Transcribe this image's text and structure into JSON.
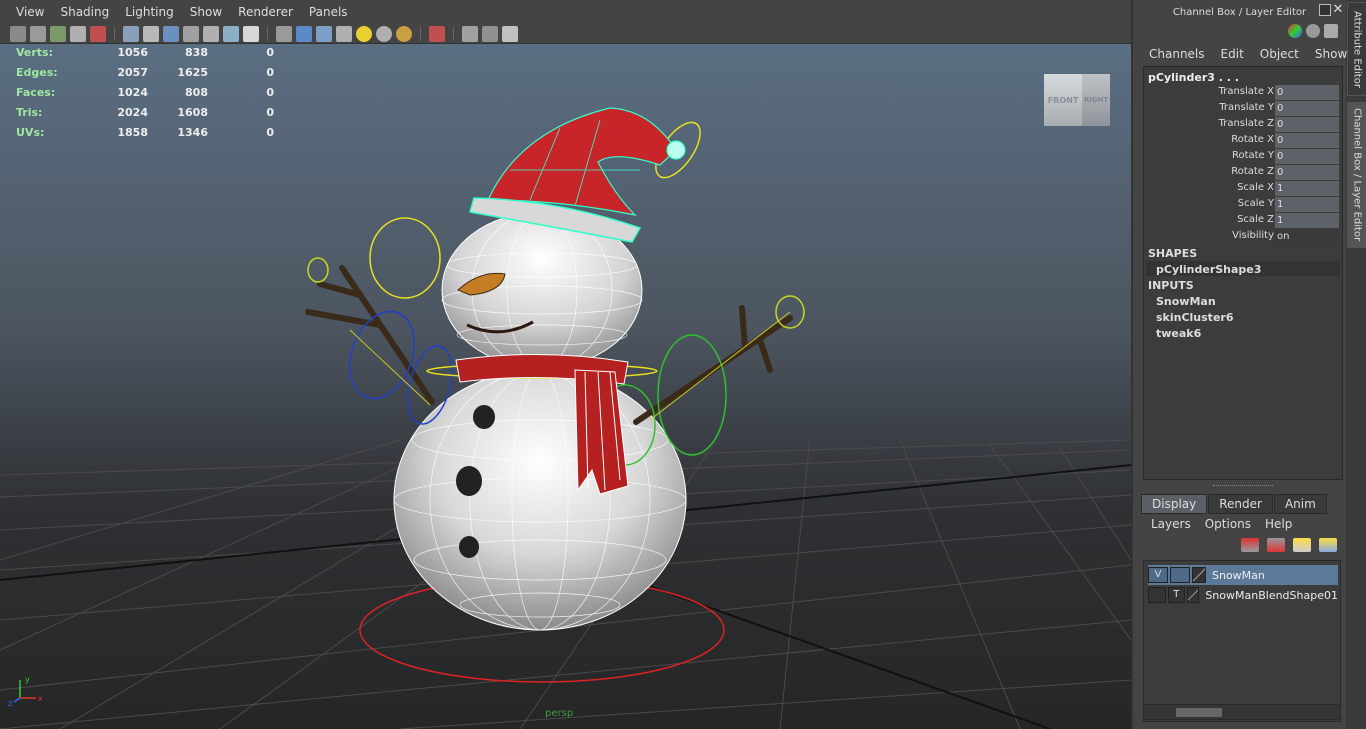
{
  "viewport": {
    "menus": [
      "View",
      "Shading",
      "Lighting",
      "Show",
      "Renderer",
      "Panels"
    ],
    "hud": [
      {
        "label": "Verts:",
        "values": [
          "1056",
          "838",
          "0"
        ]
      },
      {
        "label": "Edges:",
        "values": [
          "2057",
          "1625",
          "0"
        ]
      },
      {
        "label": "Faces:",
        "values": [
          "1024",
          "808",
          "0"
        ]
      },
      {
        "label": "Tris:",
        "values": [
          "2024",
          "1608",
          "0"
        ]
      },
      {
        "label": "UVs:",
        "values": [
          "1858",
          "1346",
          "0"
        ]
      }
    ],
    "viewcube": {
      "front": "FRONT",
      "right": "RIGHT"
    },
    "camera_label": "persp",
    "axis": {
      "x": "x",
      "y": "y",
      "z": "z"
    }
  },
  "panel": {
    "title": "Channel Box / Layer Editor",
    "side_tabs": {
      "attr": "Attribute Editor",
      "cb": "Channel Box / Layer Editor"
    },
    "menu": [
      "Channels",
      "Edit",
      "Object",
      "Show"
    ],
    "node": "pCylinder3 . . .",
    "attrs": [
      {
        "name": "Translate X",
        "value": "0"
      },
      {
        "name": "Translate Y",
        "value": "0"
      },
      {
        "name": "Translate Z",
        "value": "0"
      },
      {
        "name": "Rotate X",
        "value": "0"
      },
      {
        "name": "Rotate Y",
        "value": "0"
      },
      {
        "name": "Rotate Z",
        "value": "0"
      },
      {
        "name": "Scale X",
        "value": "1"
      },
      {
        "name": "Scale Y",
        "value": "1"
      },
      {
        "name": "Scale Z",
        "value": "1"
      },
      {
        "name": "Visibility",
        "value": "on"
      }
    ],
    "shapes_header": "SHAPES",
    "shape": "pCylinderShape3",
    "inputs_header": "INPUTS",
    "inputs": [
      "SnowMan",
      "skinCluster6",
      "tweak6"
    ]
  },
  "layers": {
    "tabs": [
      "Display",
      "Render",
      "Anim"
    ],
    "menu": [
      "Layers",
      "Options",
      "Help"
    ],
    "rows": [
      {
        "v": "V",
        "t": "",
        "name": "SnowMan"
      },
      {
        "v": "",
        "t": "T",
        "name": "SnowManBlendShape01"
      }
    ]
  },
  "colors": {
    "hud_label": "#9fe89f",
    "selection": "#5d7999",
    "hat_red": "#c8252a",
    "wire_highlight": "#33ffcc"
  }
}
